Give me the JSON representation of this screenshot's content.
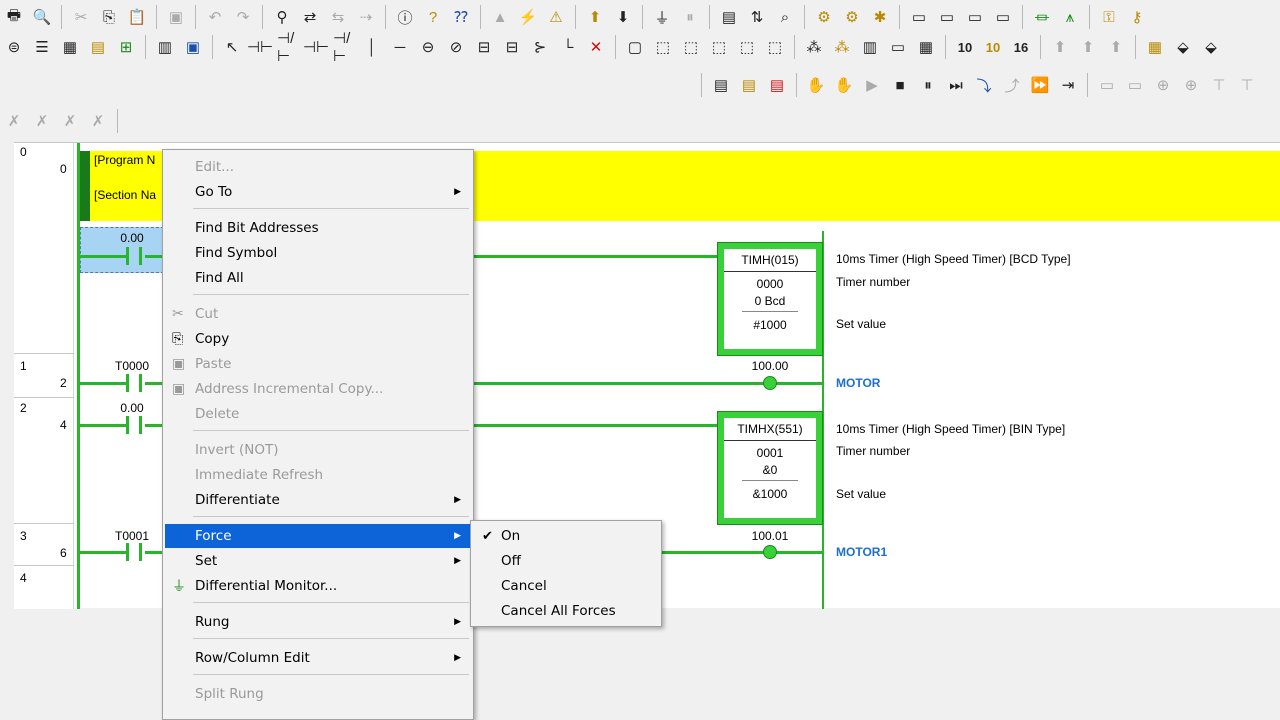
{
  "toolbar": {
    "row1_icons": [
      "print-icon",
      "print-preview-icon",
      "cut-icon",
      "copy-icon",
      "paste-icon",
      "undo-icon",
      "redo-icon",
      "find-icon",
      "replace-icon",
      "cross-reference-icon",
      "jump-icon",
      "info-icon",
      "help-icon",
      "context-help-icon",
      "warning-icon",
      "online-icon",
      "monitor-icon",
      "transfer-icon",
      "compare-icon",
      "pause-icon",
      "program-icon",
      "run-icon",
      "monitor-mode-icon"
    ],
    "row2_digits": [
      "10",
      "10",
      "16"
    ],
    "row3_icons": [
      "simulator-icon",
      "step-icon",
      "play-icon",
      "stop-icon",
      "pause-icon",
      "step-in-icon",
      "step-over-icon",
      "fast-forward-icon",
      "step-end-icon"
    ]
  },
  "diagram": {
    "rungs": [
      {
        "index": "0",
        "step": "0"
      },
      {
        "index": "1",
        "step": "2"
      },
      {
        "index": "2",
        "step": "4"
      },
      {
        "index": "3",
        "step": "6"
      },
      {
        "index": "4",
        "step": ""
      }
    ],
    "band": {
      "program_name": "[Program N",
      "section_name": "[Section Na"
    },
    "contacts": [
      {
        "label": "0.00"
      },
      {
        "label": "T0000"
      },
      {
        "label": "0.00"
      },
      {
        "label": "T0001"
      }
    ],
    "timer1": {
      "name": "TIMH(015)",
      "operand1": "0000",
      "operand2": "0 Bcd",
      "operand3": "#1000",
      "comment_title": "10ms Timer (High Speed Timer) [BCD Type]",
      "comment_timer": "Timer number",
      "comment_set": "Set value"
    },
    "coil1": {
      "address": "100.00",
      "name": "MOTOR"
    },
    "timer2": {
      "name": "TIMHX(551)",
      "operand1": "0001",
      "operand2": "&0",
      "operand3": "&1000",
      "comment_title": "10ms Timer (High Speed Timer) [BIN Type]",
      "comment_timer": "Timer number",
      "comment_set": "Set value"
    },
    "coil2": {
      "address": "100.01",
      "name": "MOTOR1"
    }
  },
  "context_menu": {
    "edit": "Edit...",
    "goto": "Go To",
    "find_bit": "Find Bit Addresses",
    "find_symbol": "Find Symbol",
    "find_all": "Find All",
    "cut": "Cut",
    "copy": "Copy",
    "paste": "Paste",
    "address_incremental_copy": "Address Incremental Copy...",
    "delete": "Delete",
    "invert": "Invert (NOT)",
    "immediate_refresh": "Immediate Refresh",
    "differentiate": "Differentiate",
    "force": "Force",
    "set": "Set",
    "differential_monitor": "Differential Monitor...",
    "rung": "Rung",
    "row_column_edit": "Row/Column Edit",
    "split_rung": "Split Rung"
  },
  "force_submenu": {
    "on": "On",
    "off": "Off",
    "cancel": "Cancel",
    "cancel_all": "Cancel All Forces"
  }
}
